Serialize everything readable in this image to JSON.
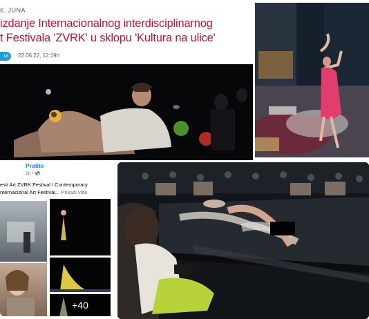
{
  "news": {
    "date_line": "6. JUNA",
    "headline_line1": "izdanje Internacionalnog interdisciplinarnog",
    "headline_line2": "t Festivala 'ZVRK' u sklopu 'Kultura na ulice'",
    "badge": "ra",
    "timestamp": "22.06.22, 12:19h"
  },
  "facebook": {
    "follow_label": "Pratite",
    "time": "2h",
    "post_line1": "esti Art ZVRK Festival / Contemporary",
    "post_line2": "nternacional Art Festival...",
    "more_label": "Prikaži više",
    "extra_photos": "+40"
  },
  "colors": {
    "headline": "#c8102e",
    "badge": "#1ba1e2",
    "fb_link": "#1877f2"
  }
}
